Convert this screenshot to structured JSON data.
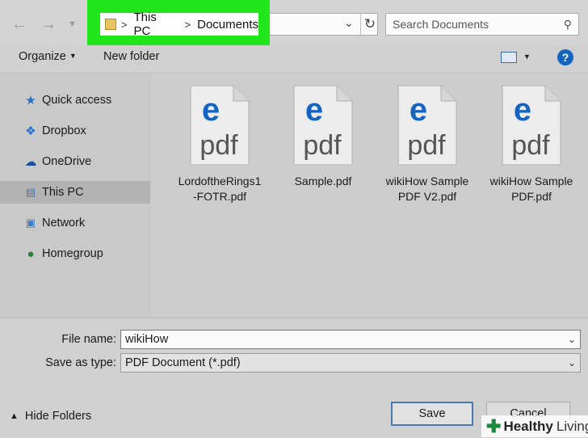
{
  "nav": {
    "back_icon": "arrow-left-icon",
    "forward_icon": "arrow-right-icon",
    "recent_icon": "chevron-down-icon",
    "up_icon": "arrow-up-icon"
  },
  "address": {
    "segments": [
      "This PC",
      "Documents"
    ],
    "separator": ">",
    "highlight_color": "#22e61c"
  },
  "search": {
    "placeholder": "Search Documents"
  },
  "toolbar": {
    "organize": "Organize",
    "new_folder": "New folder",
    "help": "?"
  },
  "sidebar": {
    "items": [
      {
        "label": "Quick access",
        "icon": "star-icon"
      },
      {
        "label": "Dropbox",
        "icon": "dropbox-icon"
      },
      {
        "label": "OneDrive",
        "icon": "cloud-icon"
      },
      {
        "label": "This PC",
        "icon": "computer-icon",
        "selected": true
      },
      {
        "label": "Network",
        "icon": "network-icon"
      },
      {
        "label": "Homegroup",
        "icon": "homegroup-icon"
      }
    ]
  },
  "files": [
    {
      "line1": "LordoftheRings1",
      "line2": "-FOTR.pdf",
      "type": "pdf"
    },
    {
      "line1": "Sample.pdf",
      "line2": "",
      "type": "pdf"
    },
    {
      "line1": "wikiHow Sample",
      "line2": "PDF V2.pdf",
      "type": "pdf"
    },
    {
      "line1": "wikiHow Sample",
      "line2": "PDF.pdf",
      "type": "pdf"
    }
  ],
  "pdf_icon_text": "pdf",
  "form": {
    "file_name_label": "File name:",
    "file_name_value": "wikiHow",
    "save_type_label": "Save as type:",
    "save_type_value": "PDF Document (*.pdf)"
  },
  "hide_folders": "Hide Folders",
  "buttons": {
    "save": "Save",
    "cancel": "Cancel"
  },
  "watermark": {
    "bold": "Healthy",
    "light": "Living"
  },
  "colors": {
    "edge_blue": "#1565c0",
    "selection_gray": "#b3b3b3"
  }
}
